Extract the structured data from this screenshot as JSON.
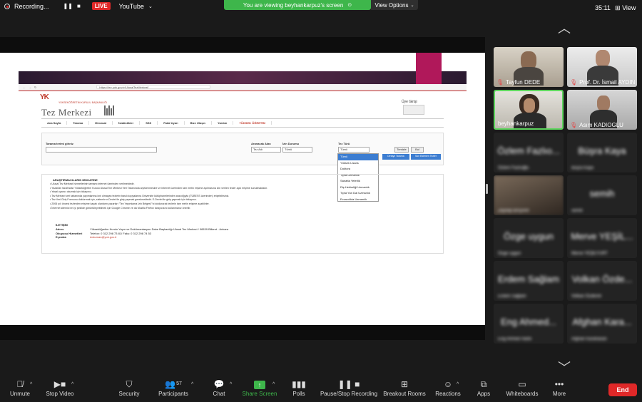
{
  "topbar": {
    "recording_label": "Recording...",
    "live_label": "LIVE",
    "platform_label": "YouTube",
    "viewing_banner": "You are viewing beyhankarpuz's screen",
    "view_options": "View Options",
    "timer": "35:11",
    "view_label": "View"
  },
  "site": {
    "url": "https://tez.yok.gov.tr/UlusalTezMerkezi/",
    "org_name": "YÜKSEKÖĞRETİM KURULU BAŞKANLIĞI",
    "title": "Tez Merkezi",
    "login": "Üye Girişi",
    "menu": [
      "Ana Sayfa",
      "Tarama",
      "Mevzuat",
      "İstatistikler",
      "SSS",
      "Fatal Uyarı",
      "Bize Ulaşın",
      "Yardım"
    ],
    "menu_special": "YÜKSEK ÖĞRETİM",
    "search": {
      "term_label": "Tarama terimi giriniz",
      "field_label": "Aranacak Alan",
      "field_value": "Tez Adı",
      "search_type_label": "İzin Durumu",
      "search_type_value": "Tümü",
      "thesis_type_label": "Tez Türü",
      "thesis_type_value": "Tümü",
      "clear_button": "Temizle",
      "find_button": "Bul",
      "detailed_button": "Detaylı Tarama",
      "latest_button": "Son Eklenen Tezler"
    },
    "dropdown_options": [
      "Tümü",
      "Yüksek Lisans",
      "Doktora",
      "Tıpta Uzmanlık",
      "Sanatta Yeterlik",
      "Diş Hekimliği Uzmanlık",
      "Tıpta Yan Dal Uzmanlık",
      "Eczacılıkta Uzmanlık"
    ],
    "notice_title": "ARAŞTIRMACILARIN DİKKATİNE",
    "notices": [
      "Ulusal Tez Merkezi hizmetlerinin tamamı internet üzerinden verilmektedir.",
      "Yazarları tarafından Yükseköğretim Kurulu Ulusal Tez Merkezi Veri Tabanında arşivlenmesine ve internet üzerinden tam metin erişime açılmasına izin verilen tezler açık erişime sunulmaktadır.",
      "Yasal uyarıcı okumak için tıklayınız.",
      "Tez Merkezi veri tabanında yayımlanma izni olmayan tezlerin basılı kopyalarına Üniversite kütüphanelerinden aracılığıyla (TÜBESS üzerinden) erişebilirsiniz.",
      "Tez Veri Giriş Formunu doldurmak için, sistemle e-Devlet ile giriş yapmak gerekmektedir. E-Devlet ile giriş yapmak için tıklayınız.",
      "2006 yılı öncesi tezlerden erişime kapalı olanların yazarları \"Tez Yayımlama İzin Belgesi\"'ni doldurarak tezlerin tam metin erişime açabilirler.",
      "İnternet sitemizi en iyi şekilde görüntüleyebilmek için Google Chrome ve da Mozilla Firefox tarayıcısını kullanmanız önerilir."
    ],
    "contact_title": "İLETİŞİM",
    "contact": [
      {
        "label": "Adres",
        "value": "Yükseköğretim Kurulu Yayın ve Dokümantasyon Daire Başkanlığı Ulusal Tez Merkezi / 06539 Bilkent - Ankara"
      },
      {
        "label": "Okuyucu Hizmetleri",
        "value": "Telefon: 0 312 298 73 81/ Faks: 0 312 298 74 53"
      },
      {
        "label": "E-posta",
        "value": "dokuman@yok.gov.tr"
      }
    ]
  },
  "participants": [
    {
      "name": "Tayfun DEDE",
      "video": true
    },
    {
      "name": "Prof. Dr. İsmail AYDIN",
      "video": true
    },
    {
      "name": "beyhankarpuz",
      "video": true,
      "active": true
    },
    {
      "name": "Asım KADIOGLU",
      "video": true
    },
    {
      "name": "Özlem Fazlıo...",
      "sub": "Özlem Fazlıoğlu",
      "video": false
    },
    {
      "name": "Büşra Kaya",
      "sub": "Büşra Kaya",
      "video": false
    },
    {
      "name": "",
      "sub": "Zeynep BAŞARI",
      "video": true
    },
    {
      "name": "semih",
      "sub": "semih",
      "video": false
    },
    {
      "name": "Özge uygun",
      "sub": "Özge uygun",
      "video": false
    },
    {
      "name": "Merve YEŞİL...",
      "sub": "Merve YEŞİLYURT",
      "video": false
    },
    {
      "name": "Erdem Sağlam",
      "sub": "Erdem Sağlam",
      "video": false
    },
    {
      "name": "Volkan Özde...",
      "sub": "Volkan Özdemir",
      "video": false
    },
    {
      "name": "Eng Ahmed...",
      "sub": "Eng Ahmed Harbi",
      "video": false
    },
    {
      "name": "Afghan Kara...",
      "sub": "Afghan Karahasan",
      "video": false
    }
  ],
  "toolbar": {
    "unmute": "Unmute",
    "stop_video": "Stop Video",
    "security": "Security",
    "participants": "Participants",
    "participants_count": "57",
    "chat": "Chat",
    "share_screen": "Share Screen",
    "polls": "Polls",
    "pause_recording": "Pause/Stop Recording",
    "breakout": "Breakout Rooms",
    "reactions": "Reactions",
    "apps": "Apps",
    "whiteboards": "Whiteboards",
    "more": "More",
    "end": "End"
  },
  "colors": {
    "share_green": "#3eb64b",
    "live_red": "#e02828",
    "active_border": "#5ed55e",
    "yok_red": "#c0392b",
    "button_blue": "#3c7dd1"
  }
}
